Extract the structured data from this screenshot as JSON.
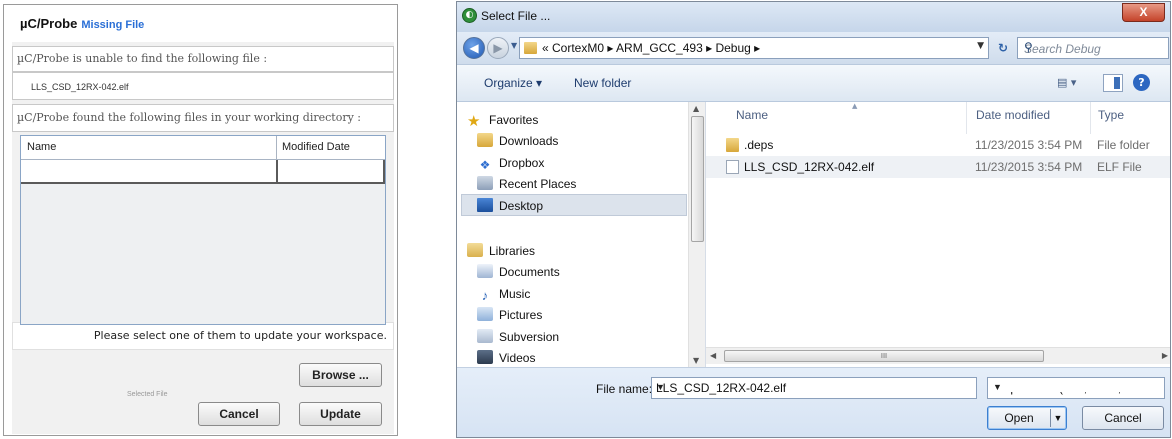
{
  "left_dialog": {
    "app_name": "µC/Probe",
    "title": "Missing File",
    "not_found_label": "µC/Probe is unable to find the following file :",
    "missing_file": "LLS_CSD_12RX-042.elf",
    "found_label": "µC/Probe found the following files in your working directory :",
    "table_headers": [
      "Name",
      "Modified Date"
    ],
    "select_hint": "Please select one of them to update your workspace.",
    "browse_label": "Browse ...",
    "selected_file_label": "Selected File",
    "cancel_label": "Cancel",
    "update_label": "Update"
  },
  "file_dialog": {
    "title": "Select File ...",
    "close_label": "X",
    "breadcrumb": "« CortexM0 ▸ ARM_GCC_493 ▸ Debug ▸",
    "search_placeholder": "Search Debug",
    "toolbar": {
      "organize_label": "Organize ▾",
      "new_folder_label": "New folder"
    },
    "nav": {
      "favorites": [
        "Favorites",
        "Downloads",
        "Dropbox",
        "Recent Places",
        "Desktop"
      ],
      "libraries": [
        "Libraries",
        "Documents",
        "Music",
        "Pictures",
        "Subversion",
        "Videos"
      ],
      "selected": "Desktop"
    },
    "columns": [
      "Name",
      "Date modified",
      "Type"
    ],
    "files": [
      {
        "name": ".deps",
        "date": "11/23/2015 3:54 PM",
        "type": "File folder",
        "icon": "folder-icon"
      },
      {
        "name": "LLS_CSD_12RX-042.elf",
        "date": "11/23/2015 3:54 PM",
        "type": "ELF File",
        "icon": "file-icon"
      }
    ],
    "file_name_label": "File name:",
    "file_name_value": "LLS_CSD_12RX-042.elf",
    "file_type_value": "Output Files (*.elf, *.abs, *.ax",
    "open_label": "Open",
    "cancel_label": "Cancel"
  }
}
